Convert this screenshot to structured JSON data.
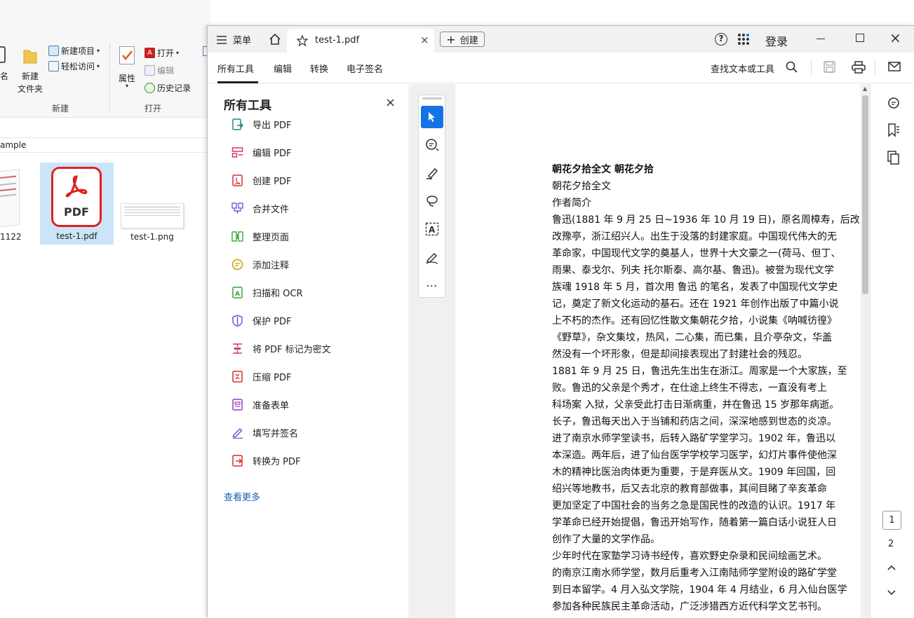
{
  "explorer": {
    "ribbon": {
      "new_item": "新建项目",
      "easy_access": "轻松访问",
      "new_folder_line1": "新建",
      "new_folder_line2": "文件夹",
      "group_new": "新建",
      "open": "打开",
      "edit": "编辑",
      "history": "历史记录",
      "properties": "属性",
      "group_open": "打开",
      "partial_label": "名"
    },
    "address": "ample",
    "files": [
      {
        "name": "1122"
      },
      {
        "name": "test-1.pdf",
        "icon_text": "PDF"
      },
      {
        "name": "test-1.png"
      }
    ]
  },
  "acrobat": {
    "menu_label": "菜单",
    "tab_title": "test-1.pdf",
    "create_label": "创建",
    "login": "登录",
    "menubar": {
      "all_tools": "所有工具",
      "edit": "编辑",
      "convert": "转换",
      "esign": "电子签名",
      "search": "查找文本或工具"
    },
    "panel": {
      "title": "所有工具",
      "tools": [
        {
          "label": "导出 PDF",
          "icon": "export-pdf-icon",
          "color": "#1b8a8a"
        },
        {
          "label": "编辑 PDF",
          "icon": "edit-pdf-icon",
          "color": "#d8326a"
        },
        {
          "label": "创建 PDF",
          "icon": "create-pdf-icon",
          "color": "#d33030"
        },
        {
          "label": "合并文件",
          "icon": "combine-files-icon",
          "color": "#6c59d6"
        },
        {
          "label": "整理页面",
          "icon": "organize-pages-icon",
          "color": "#3aa43a"
        },
        {
          "label": "添加注释",
          "icon": "comment-icon",
          "color": "#c9a100"
        },
        {
          "label": "扫描和 OCR",
          "icon": "scan-ocr-icon",
          "color": "#3aa43a"
        },
        {
          "label": "保护 PDF",
          "icon": "protect-pdf-icon",
          "color": "#6c59d6"
        },
        {
          "label": "将 PDF 标记为密文",
          "icon": "redact-icon",
          "color": "#d8326a"
        },
        {
          "label": "压缩 PDF",
          "icon": "compress-pdf-icon",
          "color": "#d33030"
        },
        {
          "label": "准备表单",
          "icon": "prepare-form-icon",
          "color": "#9a3fc4"
        },
        {
          "label": "填写并签名",
          "icon": "fill-sign-icon",
          "color": "#7a4fd0"
        },
        {
          "label": "转换为 PDF",
          "icon": "convert-pdf-icon",
          "color": "#d33030"
        }
      ],
      "see_more": "查看更多"
    },
    "document": {
      "title": "朝花夕拾全文 朝花夕拾",
      "lines": [
        "朝花夕拾全文",
        "作者简介",
        "鲁迅(1881 年 9 月 25 日~1936 年 10 月 19 日)，原名周樟寿，后改",
        "改豫亭，浙江绍兴人。出生于没落的封建家庭。中国现代伟大的无",
        "革命家，中国现代文学的奠基人，世界十大文豪之一(荷马、但丁、",
        "雨果、泰戈尔、列夫 托尔斯泰、高尔基、鲁迅)。被誉为现代文学",
        "族魂 1918 年 5 月，首次用 鲁迅 的笔名，发表了中国现代文学史",
        "记，奠定了新文化运动的基石。还在 1921 年创作出版了中篇小说",
        "上不朽的杰作。还有回忆性散文集朝花夕拾，小说集《呐喊彷徨》",
        "《野草》，杂文集坟，热风，二心集，而已集，且介亭杂文，华盖",
        "然没有一个坏形象，但是却间接表现出了封建社会的残忍。",
        "1881 年 9 月 25 日，鲁迅先生出生在浙江。周家是一个大家族，至",
        "败。鲁迅的父亲是个秀才，在仕途上终生不得志，一直没有考上",
        "科场案 入狱，父亲受此打击日渐病重，并在鲁迅 15 岁那年病逝。",
        "长子，鲁迅每天出入于当铺和药店之间，深深地感到世态的炎凉。",
        "进了南京水师学堂读书，后转入路矿学堂学习。1902 年，鲁迅以",
        "本深造。两年后，进了仙台医学学校学习医学，幻灯片事件使他深",
        "木的精神比医治肉体更为重要，于是弃医从文。1909 年回国，回",
        "绍兴等地教书，后又去北京的教育部做事，其间目睹了辛亥革命",
        "更加坚定了中国社会的当务之急是国民性的改造的认识。1917 年",
        "学革命已经开始提倡，鲁迅开始写作，随着第一篇白话小说狂人日",
        "创作了大量的文学作品。",
        "少年时代在家塾学习诗书经传，喜欢野史杂录和民间绘画艺术。",
        "的南京江南水师学堂，数月后重考入江南陆师学堂附设的路矿学堂",
        "到日本留学。4 月入弘文学院，1904 年 4 月结业，6 月入仙台医学",
        "参加各种民族民主革命活动，广泛涉猎西方近代科学文艺书刊。"
      ]
    },
    "pages": {
      "current": "1",
      "next": "2"
    }
  }
}
